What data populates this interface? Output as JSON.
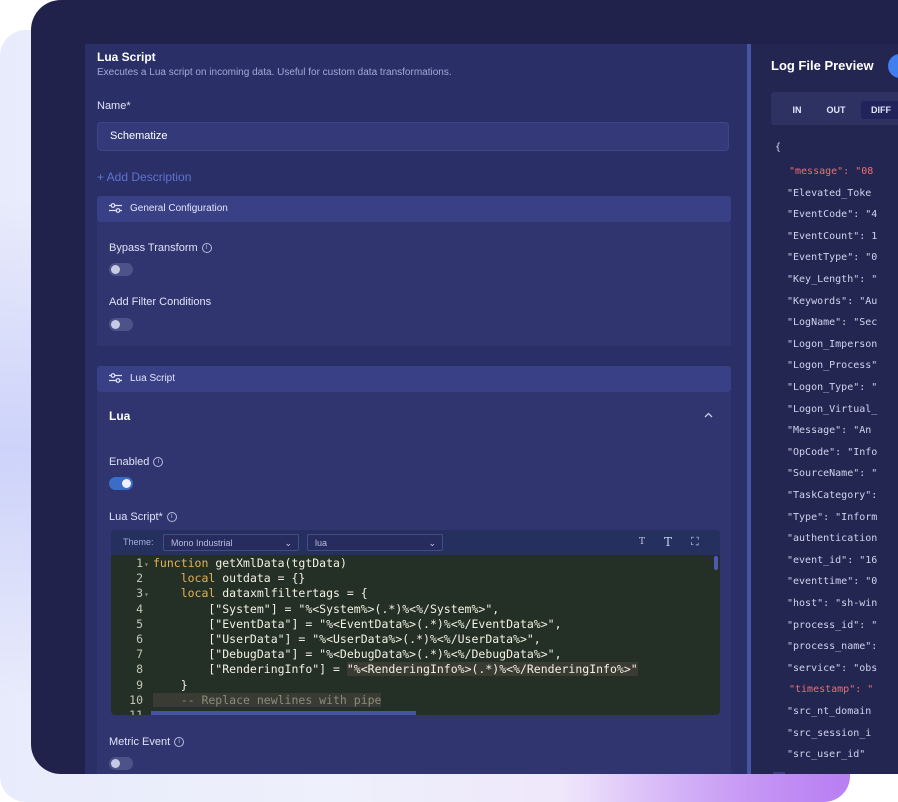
{
  "panel": {
    "title": "Lua Script",
    "subtitle": "Executes a Lua script on incoming data. Useful for custom data transformations.",
    "name_label": "Name*",
    "name_value": "Schematize",
    "add_description": "+ Add Description"
  },
  "general": {
    "header": "General Configuration",
    "bypass_label": "Bypass Transform",
    "bypass_on": false,
    "filter_label": "Add Filter Conditions",
    "filter_on": false
  },
  "lua_section": {
    "header": "Lua Script",
    "lua_title": "Lua",
    "enabled_label": "Enabled",
    "enabled_on": true,
    "script_label": "Lua Script*",
    "theme_label": "Theme:",
    "theme_value": "Mono Industrial",
    "lang_value": "lua",
    "metric_label": "Metric Event",
    "metric_on": false,
    "info_glyph": "i",
    "collapse_icon": "chevron-up",
    "editor_icons": [
      "T",
      "T",
      "⛶"
    ]
  },
  "code": {
    "line_numbers": [
      "1",
      "2",
      "3",
      "4",
      "5",
      "6",
      "7",
      "8",
      "9",
      "10",
      "11"
    ],
    "lines": [
      "function getXmlData(tgtData)",
      "    local outdata = {}",
      "    local dataxmlfiltertags = {",
      "        [\"System\"] = \"%<System%>(.*)%<%/System%>\",",
      "        [\"EventData\"] = \"%<EventData%>(.*)%<%/EventData%>\",",
      "        [\"UserData\"] = \"%<UserData%>(.*)%<%/UserData%>\",",
      "        [\"DebugData\"] = \"%<DebugData%>(.*)%<%/DebugData%>\",",
      "        [\"RenderingInfo\"] = \"%<RenderingInfo%>(.*)%<%/RenderingInfo%>\"",
      "    }",
      "    -- Replace newlines with pipe",
      ""
    ]
  },
  "preview": {
    "title": "Log File Preview",
    "tabs": [
      "IN",
      "OUT",
      "DIFF"
    ],
    "open_brace": "{",
    "json_lines": [
      {
        "text": "\"message\": \"08",
        "red": true
      },
      {
        "text": "\"Elevated_Toke",
        "red": false
      },
      {
        "text": "\"EventCode\": \"4",
        "red": false
      },
      {
        "text": "\"EventCount\": 1",
        "red": false
      },
      {
        "text": "\"EventType\": \"0",
        "red": false
      },
      {
        "text": "\"Key_Length\": \"",
        "red": false
      },
      {
        "text": "\"Keywords\": \"Au",
        "red": false
      },
      {
        "text": "\"LogName\": \"Sec",
        "red": false
      },
      {
        "text": "\"Logon_Imperson",
        "red": false
      },
      {
        "text": "\"Logon_Process\"",
        "red": false
      },
      {
        "text": "\"Logon_Type\": \"",
        "red": false
      },
      {
        "text": "\"Logon_Virtual_",
        "red": false
      },
      {
        "text": "\"Message\": \"An ",
        "red": false
      },
      {
        "text": "\"OpCode\": \"Info",
        "red": false
      },
      {
        "text": "\"SourceName\": \"",
        "red": false
      },
      {
        "text": "\"TaskCategory\":",
        "red": false
      },
      {
        "text": "\"Type\": \"Inform",
        "red": false
      },
      {
        "text": "\"authentication",
        "red": false
      },
      {
        "text": "\"event_id\": \"16",
        "red": false
      },
      {
        "text": "\"eventtime\": \"0",
        "red": false
      },
      {
        "text": "\"host\": \"sh-win",
        "red": false
      },
      {
        "text": "\"process_id\": \"",
        "red": false
      },
      {
        "text": "\"process_name\":",
        "red": false
      },
      {
        "text": "\"service\": \"obs",
        "red": false
      },
      {
        "text": "\"timestamp\": \"",
        "red": true
      },
      {
        "text": "\"src_nt_domain",
        "red": false
      },
      {
        "text": "\"src_session_i",
        "red": false
      },
      {
        "text": "\"src_user_id\"",
        "red": false
      }
    ]
  }
}
